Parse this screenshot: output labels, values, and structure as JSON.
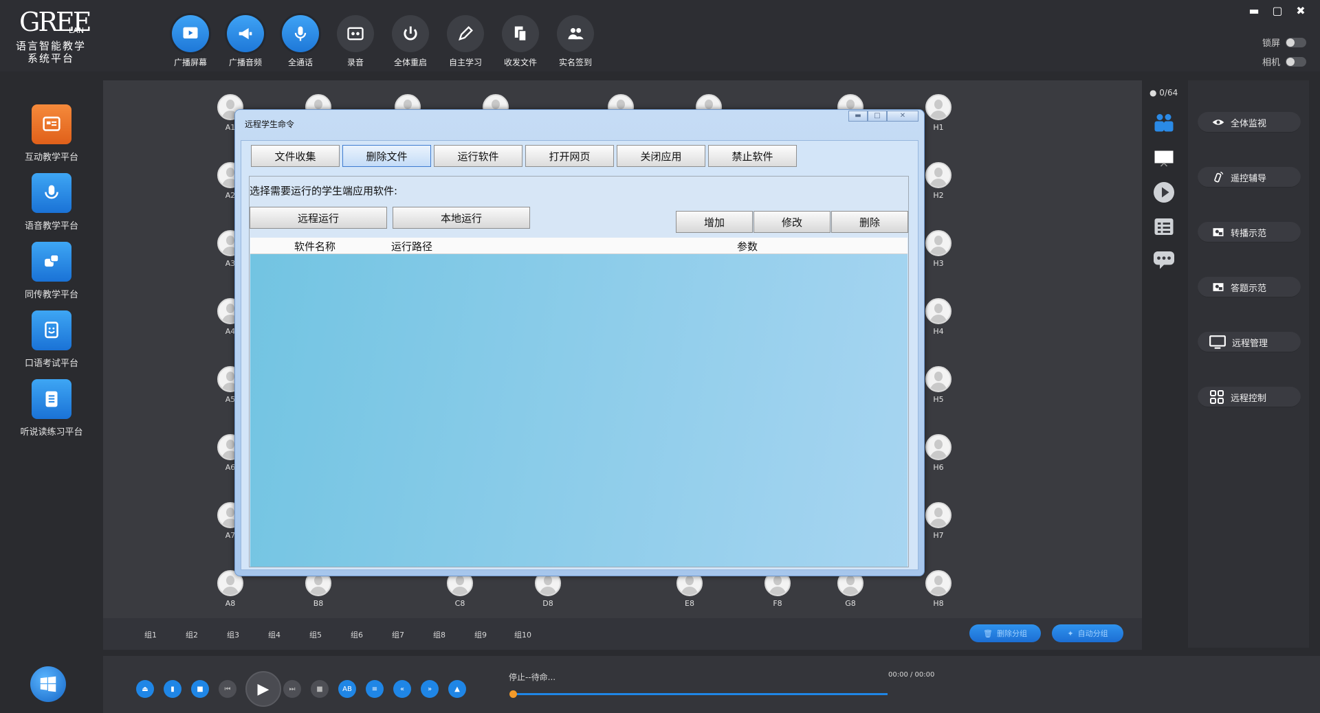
{
  "app": {
    "logo_text": "GREE",
    "logo_suffix": "LAN",
    "logo_subtitle": "语言智能教学系统平台"
  },
  "toolbar": [
    {
      "label": "广播屏幕",
      "icon": "broadcast-screen-icon",
      "active": true
    },
    {
      "label": "广播音频",
      "icon": "megaphone-icon",
      "active": true
    },
    {
      "label": "全通话",
      "icon": "microphone-icon",
      "active": true
    },
    {
      "label": "录音",
      "icon": "recorder-icon",
      "active": false
    },
    {
      "label": "全体重启",
      "icon": "power-icon",
      "active": false
    },
    {
      "label": "自主学习",
      "icon": "pencil-icon",
      "active": false
    },
    {
      "label": "收发文件",
      "icon": "file-transfer-icon",
      "active": false
    },
    {
      "label": "实名签到",
      "icon": "users-icon",
      "active": false
    }
  ],
  "toggles": {
    "lock_screen": "锁屏",
    "camera": "相机",
    "state": "OFF"
  },
  "sidebar": [
    {
      "label": "互动教学平台",
      "icon": "interactive-icon",
      "color": "#f07a2e"
    },
    {
      "label": "语音教学平台",
      "icon": "voice-icon",
      "color": "#2a8ae6"
    },
    {
      "label": "同传教学平台",
      "icon": "translate-icon",
      "color": "#2a8ae6"
    },
    {
      "label": "口语考试平台",
      "icon": "exam-icon",
      "color": "#2a8ae6"
    },
    {
      "label": "听说读练习平台",
      "icon": "practice-icon",
      "color": "#2a8ae6"
    }
  ],
  "seats": {
    "col_a": [
      "A1",
      "A2",
      "A3",
      "A4",
      "A5",
      "A6",
      "A7",
      "A8"
    ],
    "col_h": [
      "H1",
      "H2",
      "H3",
      "H4",
      "H5",
      "H6",
      "H7",
      "H8"
    ],
    "bottom_row": [
      "A8",
      "B8",
      "C8",
      "D8",
      "E8",
      "F8",
      "G8",
      "H8"
    ]
  },
  "groups": [
    "组1",
    "组2",
    "组3",
    "组4",
    "组5",
    "组6",
    "组7",
    "组8",
    "组9",
    "组10"
  ],
  "group_actions": {
    "delete": "删除分组",
    "auto": "自动分组"
  },
  "online_count": "0/64",
  "right_panel": [
    {
      "label": "全体监视",
      "icon": "eye-icon"
    },
    {
      "label": "遥控辅导",
      "icon": "remote-icon"
    },
    {
      "label": "转播示范",
      "icon": "relay-icon"
    },
    {
      "label": "答题示范",
      "icon": "answer-icon"
    },
    {
      "label": "远程管理",
      "icon": "monitor-icon"
    },
    {
      "label": "远程控制",
      "icon": "grid-icon"
    }
  ],
  "player": {
    "status": "停止--待命...",
    "time": "00:00 / 00:00",
    "progress": 0
  },
  "dialog": {
    "title": "远程学生命令",
    "tabs": [
      "文件收集",
      "删除文件",
      "运行软件",
      "打开网页",
      "关闭应用",
      "禁止软件"
    ],
    "active_tab": "删除文件",
    "prompt": "选择需要运行的学生端应用软件:",
    "run_remote": "远程运行",
    "run_local": "本地运行",
    "add": "增加",
    "edit": "修改",
    "delete": "删除",
    "columns": [
      "软件名称",
      "运行路径",
      "参数"
    ]
  }
}
